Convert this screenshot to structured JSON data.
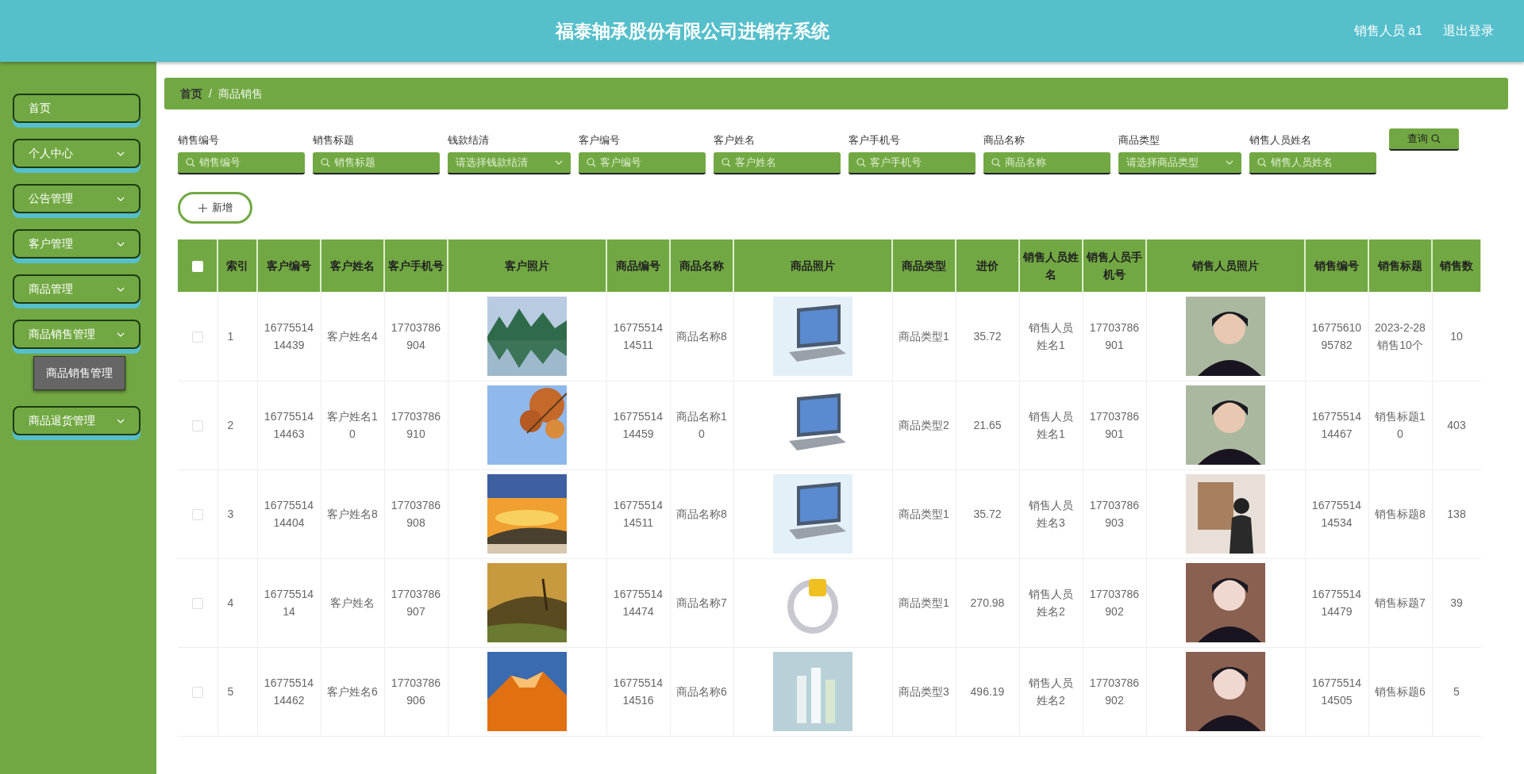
{
  "header": {
    "title": "福泰轴承股份有限公司进销存系统",
    "user": "销售人员 a1",
    "logout": "退出登录"
  },
  "sidebar": {
    "items": [
      {
        "label": "首页",
        "expandable": false
      },
      {
        "label": "个人中心",
        "expandable": true
      },
      {
        "label": "公告管理",
        "expandable": true
      },
      {
        "label": "客户管理",
        "expandable": true
      },
      {
        "label": "商品管理",
        "expandable": true
      },
      {
        "label": "商品销售管理",
        "expandable": true,
        "children": [
          {
            "label": "商品销售管理"
          }
        ]
      },
      {
        "label": "商品退货管理",
        "expandable": true
      }
    ]
  },
  "breadcrumb": [
    "首页",
    "商品销售"
  ],
  "breadcrumb_separator": "/",
  "filters": [
    {
      "label": "销售编号",
      "kind": "text",
      "placeholder": "销售编号"
    },
    {
      "label": "销售标题",
      "kind": "text",
      "placeholder": "销售标题"
    },
    {
      "label": "钱款结清",
      "kind": "select",
      "placeholder": "请选择钱款结清"
    },
    {
      "label": "客户编号",
      "kind": "text",
      "placeholder": "客户编号"
    },
    {
      "label": "客户姓名",
      "kind": "text",
      "placeholder": "客户姓名"
    },
    {
      "label": "客户手机号",
      "kind": "text",
      "placeholder": "客户手机号"
    },
    {
      "label": "商品名称",
      "kind": "text",
      "placeholder": "商品名称"
    },
    {
      "label": "商品类型",
      "kind": "select",
      "placeholder": "请选择商品类型"
    },
    {
      "label": "销售人员姓名",
      "kind": "text",
      "placeholder": "销售人员姓名"
    }
  ],
  "query_button": "查询",
  "add_button": "新增",
  "table": {
    "select_all_checked": false,
    "columns": [
      {
        "label": "索引",
        "kind": "text"
      },
      {
        "label": "客户编号",
        "kind": "text"
      },
      {
        "label": "客户姓名",
        "kind": "text"
      },
      {
        "label": "客户手机号",
        "kind": "text"
      },
      {
        "label": "客户照片",
        "kind": "picture"
      },
      {
        "label": "商品编号",
        "kind": "text"
      },
      {
        "label": "商品名称",
        "kind": "text"
      },
      {
        "label": "商品照片",
        "kind": "picture"
      },
      {
        "label": "商品类型",
        "kind": "text"
      },
      {
        "label": "进价",
        "kind": "text"
      },
      {
        "label": "销售人员姓名",
        "kind": "text"
      },
      {
        "label": "销售人员手机号",
        "kind": "text"
      },
      {
        "label": "销售人员照片",
        "kind": "picture"
      },
      {
        "label": "销售编号",
        "kind": "text"
      },
      {
        "label": "销售标题",
        "kind": "text"
      },
      {
        "label": "销售数",
        "kind": "text"
      }
    ],
    "rows": [
      {
        "checked": false,
        "cells": [
          "1",
          "1677551414439",
          "客户姓名4",
          "17703786904",
          "",
          "1677551414511",
          "商品名称8",
          "",
          "商品类型1",
          "35.72",
          "销售人员姓名1",
          "17703786901",
          "",
          "1677561095782",
          "2023-2-28销售10个",
          "10"
        ]
      },
      {
        "checked": false,
        "cells": [
          "2",
          "1677551414463",
          "客户姓名10",
          "17703786910",
          "",
          "1677551414459",
          "商品名称10",
          "",
          "商品类型2",
          "21.65",
          "销售人员姓名1",
          "17703786901",
          "",
          "1677551414467",
          "销售标题10",
          "403"
        ]
      },
      {
        "checked": false,
        "cells": [
          "3",
          "1677551414404",
          "客户姓名8",
          "17703786908",
          "",
          "1677551414511",
          "商品名称8",
          "",
          "商品类型1",
          "35.72",
          "销售人员姓名3",
          "17703786903",
          "",
          "1677551414534",
          "销售标题8",
          "138"
        ]
      },
      {
        "checked": false,
        "cells": [
          "4",
          "1677551414",
          "客户姓名",
          "17703786907",
          "",
          "1677551414474",
          "商品名称7",
          "",
          "商品类型1",
          "270.98",
          "销售人员姓名2",
          "17703786902",
          "",
          "1677551414479",
          "销售标题7",
          "39"
        ]
      },
      {
        "checked": false,
        "cells": [
          "5",
          "1677551414462",
          "客户姓名6",
          "17703786906",
          "",
          "1677551414516",
          "商品名称6",
          "",
          "商品类型3",
          "496.19",
          "销售人员姓名2",
          "17703786902",
          "",
          "1677551414505",
          "销售标题6",
          "5"
        ]
      }
    ]
  }
}
